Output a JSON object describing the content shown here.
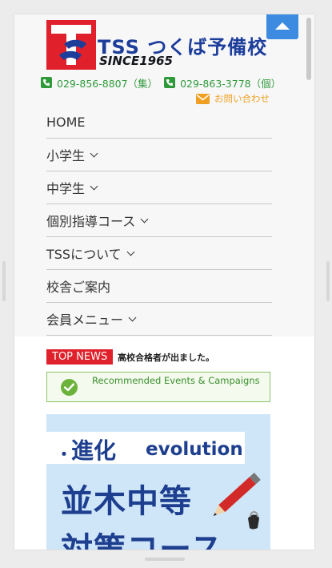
{
  "header": {
    "logo_title": "TSS つくば予備校",
    "logo_since": "SINCE1965",
    "phone_group": "029-856-8807（集）",
    "phone_individual": "029-863-3778（個）",
    "inquiry_label": "お問い合わせ"
  },
  "menu": {
    "items": [
      {
        "label": "HOME",
        "has_submenu": false
      },
      {
        "label": "小学生",
        "has_submenu": true
      },
      {
        "label": "中学生",
        "has_submenu": true
      },
      {
        "label": "個別指導コース",
        "has_submenu": true
      },
      {
        "label": "TSSについて",
        "has_submenu": true
      },
      {
        "label": "校舎ご案内",
        "has_submenu": false
      },
      {
        "label": "会員メニュー",
        "has_submenu": true
      }
    ]
  },
  "news": {
    "label": "TOP NEWS",
    "text": "高校合格者が出ました。"
  },
  "events": {
    "label": "Recommended Events & Campaigns"
  },
  "banner": {
    "dot": "・",
    "kanji": "進化",
    "evolution": "evolution",
    "line1": "並木中等",
    "line2": "対策コース"
  },
  "colors": {
    "brand_blue": "#1c3d9a",
    "brand_red": "#e0202a",
    "phone_green": "#2f9a3a",
    "inquiry_orange": "#f0a020",
    "scroll_top_blue": "#3d8be0",
    "events_green": "#6cb33b"
  },
  "icons": {
    "phone": "phone-icon",
    "mail": "mail-icon",
    "chevron": "chevron-down-icon",
    "check": "check-circle-icon",
    "scroll_top": "arrow-up-icon"
  }
}
